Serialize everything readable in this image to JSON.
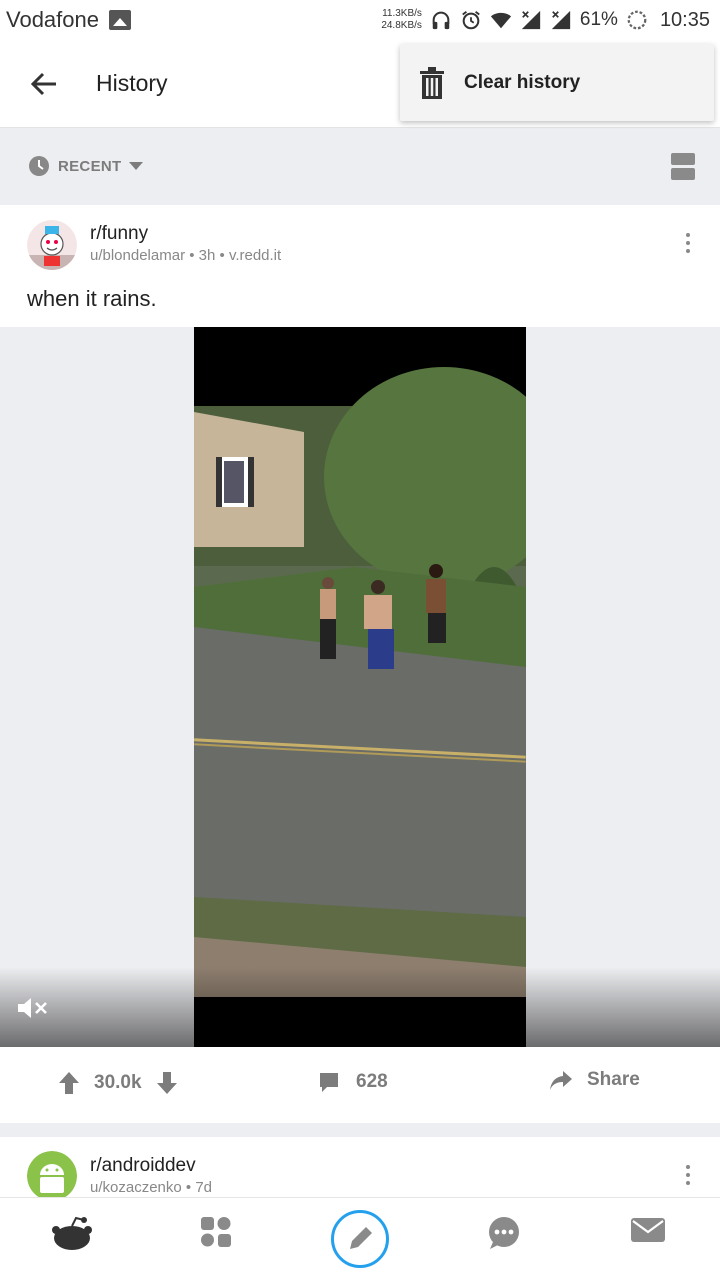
{
  "status_bar": {
    "carrier": "Vodafone",
    "net_up": "11.3KB/s",
    "net_down": "24.8KB/s",
    "battery": "61%",
    "time": "10:35"
  },
  "app_bar": {
    "title": "History"
  },
  "menu": {
    "clear_history": "Clear history"
  },
  "filter": {
    "sort_label": "RECENT"
  },
  "posts": [
    {
      "subreddit": "r/funny",
      "user": "u/blondelamar",
      "age": "3h",
      "domain": "v.redd.it",
      "title": "when it rains.",
      "votes": "30.0k",
      "comments": "628",
      "share_label": "Share"
    },
    {
      "subreddit": "r/androiddev",
      "user": "u/kozaczenko",
      "age": "7d"
    }
  ],
  "colors": {
    "accent": "#24a0ed",
    "muted": "#7c7c7c",
    "background": "#edeef1"
  },
  "icons": [
    "back-arrow-icon",
    "trash-icon",
    "clock-icon",
    "view-mode-icon",
    "more-vert-icon",
    "mute-icon",
    "upvote-icon",
    "downvote-icon",
    "comment-icon",
    "share-icon",
    "home-icon",
    "communities-icon",
    "compose-icon",
    "chat-icon",
    "inbox-icon"
  ]
}
